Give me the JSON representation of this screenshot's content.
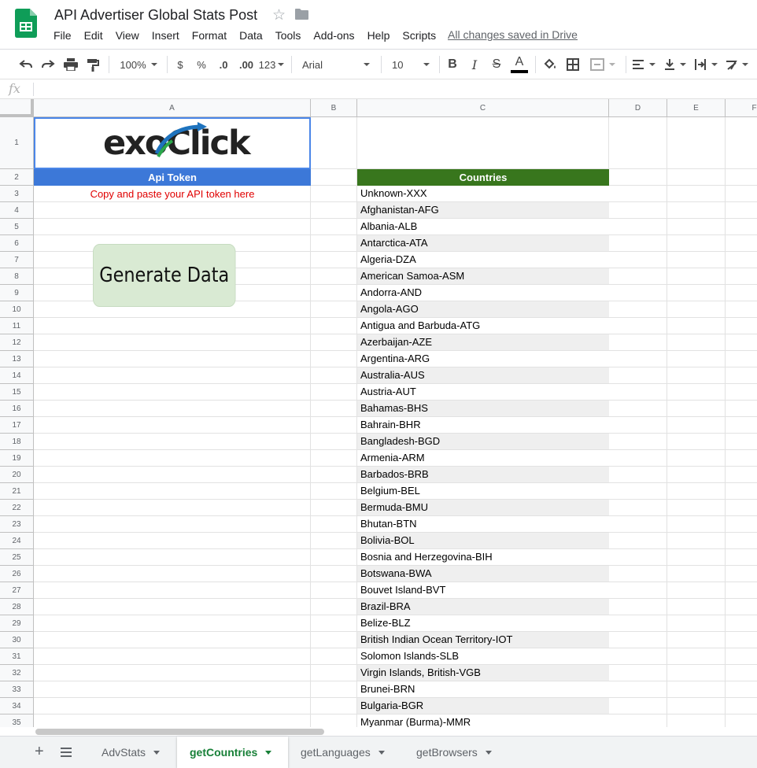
{
  "doc": {
    "title": "API Advertiser Global Stats Post",
    "saved_status": "All changes saved in Drive"
  },
  "menu": [
    "File",
    "Edit",
    "View",
    "Insert",
    "Format",
    "Data",
    "Tools",
    "Add-ons",
    "Help",
    "Scripts"
  ],
  "toolbar": {
    "zoom": "100%",
    "currency": "$",
    "percent": "%",
    "decrease_decimal": ".0",
    "increase_decimal": ".00",
    "more_formats": "123",
    "font": "Arial",
    "font_size": "10",
    "bold": "B",
    "italic": "I",
    "strike": "S",
    "text_color": "A"
  },
  "formula_bar": {
    "fx": "fx",
    "value": ""
  },
  "columns": [
    "A",
    "B",
    "C",
    "D",
    "E",
    "F"
  ],
  "rows": [
    "1",
    "2",
    "3",
    "4",
    "5",
    "6",
    "7",
    "8",
    "9",
    "10",
    "11",
    "12",
    "13",
    "14",
    "15",
    "16",
    "17",
    "18",
    "19",
    "20",
    "21",
    "22",
    "23",
    "24",
    "25",
    "26",
    "27",
    "28",
    "29",
    "30",
    "31",
    "32",
    "33",
    "34",
    "35"
  ],
  "sheet": {
    "logo_text": "exoClick",
    "api_token_header": "Api Token",
    "api_token_hint": "Copy and paste your API token here",
    "generate_button": "Generate Data",
    "countries_header": "Countries",
    "countries": [
      "Unknown-XXX",
      "Afghanistan-AFG",
      "Albania-ALB",
      "Antarctica-ATA",
      "Algeria-DZA",
      "American Samoa-ASM",
      "Andorra-AND",
      "Angola-AGO",
      "Antigua and Barbuda-ATG",
      "Azerbaijan-AZE",
      "Argentina-ARG",
      "Australia-AUS",
      "Austria-AUT",
      "Bahamas-BHS",
      "Bahrain-BHR",
      "Bangladesh-BGD",
      "Armenia-ARM",
      "Barbados-BRB",
      "Belgium-BEL",
      "Bermuda-BMU",
      "Bhutan-BTN",
      "Bolivia-BOL",
      "Bosnia and Herzegovina-BIH",
      "Botswana-BWA",
      "Bouvet Island-BVT",
      "Brazil-BRA",
      "Belize-BLZ",
      "British Indian Ocean Territory-IOT",
      "Solomon Islands-SLB",
      "Virgin Islands, British-VGB",
      "Brunei-BRN",
      "Bulgaria-BGR",
      "Myanmar (Burma)-MMR"
    ]
  },
  "tabs": [
    {
      "label": "AdvStats",
      "active": false
    },
    {
      "label": "getCountries",
      "active": true
    },
    {
      "label": "getLanguages",
      "active": false
    },
    {
      "label": "getBrowsers",
      "active": false
    }
  ],
  "colors": {
    "api_header_bg": "#3c78d8",
    "countries_header_bg": "#38761d",
    "hint_text": "#e00000",
    "button_bg": "#d9ead3",
    "active_tab": "#188038"
  }
}
